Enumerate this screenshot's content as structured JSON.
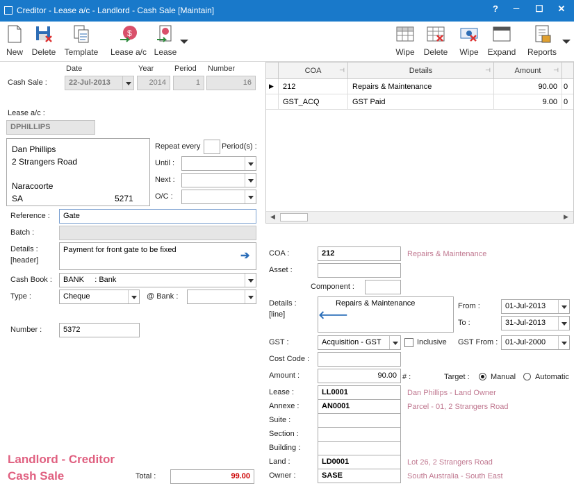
{
  "window": {
    "title": "Creditor - Lease a/c - Landlord - Cash Sale [Maintain]",
    "help": "?",
    "minimize": "─",
    "maximize": "☐",
    "close": "✕"
  },
  "toolbar_left": {
    "new": "New",
    "delete": "Delete",
    "template": "Template",
    "lease_ac": "Lease a/c",
    "lease": "Lease"
  },
  "toolbar_right": {
    "wipe1": "Wipe",
    "delete": "Delete",
    "wipe2": "Wipe",
    "expand": "Expand",
    "reports": "Reports"
  },
  "header": {
    "col_date": "Date",
    "col_year": "Year",
    "col_period": "Period",
    "col_number": "Number",
    "cash_sale_label": "Cash Sale :",
    "date": "22-Jul-2013",
    "year": "2014",
    "period": "1",
    "number": "16"
  },
  "lease_ac": {
    "label": "Lease a/c :",
    "code": "DPHILLIPS",
    "address": [
      "Dan Phillips",
      "2 Strangers Road",
      "",
      "Naracoorte"
    ],
    "state": "SA",
    "postcode": "5271"
  },
  "repeat": {
    "repeat_every": "Repeat every",
    "periods": "Period(s) :",
    "until": "Until :",
    "next": "Next :",
    "oc": "O/C :"
  },
  "form": {
    "reference_label": "Reference :",
    "reference": "Gate",
    "batch_label": "Batch :",
    "details_label": "Details :",
    "details_sub": "[header]",
    "details": "Payment for front gate to be fixed",
    "cashbook_label": "Cash Book :",
    "cashbook": "BANK     : Bank",
    "type_label": "Type :",
    "type": "Cheque",
    "at_bank_label": "@ Bank :",
    "number_label": "Number :",
    "number": "5372"
  },
  "footer": {
    "brand_line1": "Landlord - Creditor",
    "brand_line2": "Cash Sale",
    "total_label": "Total :",
    "total": "99.00"
  },
  "grid": {
    "headers": [
      "COA",
      "Details",
      "Amount",
      ""
    ],
    "rows": [
      {
        "coa": "212",
        "details": "Repairs & Maintenance",
        "amount": "90.00",
        "extra": "0"
      },
      {
        "coa": "GST_ACQ",
        "details": "GST Paid",
        "amount": "9.00",
        "extra": "0"
      }
    ]
  },
  "line": {
    "coa_label": "COA :",
    "coa": "212",
    "coa_desc": "Repairs & Maintenance",
    "asset_label": "Asset :",
    "component_label": "Component :",
    "details_label": "Details :",
    "details_sub": "[line]",
    "details": "Repairs & Maintenance",
    "from_label": "From :",
    "from": "01-Jul-2013",
    "to_label": "To :",
    "to": "31-Jul-2013",
    "gst_label": "GST :",
    "gst": "Acquisition - GST",
    "inclusive": "Inclusive",
    "gst_from_label": "GST From :",
    "gst_from": "01-Jul-2000",
    "cost_code_label": "Cost Code :",
    "amount_label": "Amount :",
    "amount": "90.00",
    "hash": "# :",
    "target_label": "Target :",
    "manual": "Manual",
    "automatic": "Automatic",
    "lease_label": "Lease :",
    "lease": "LL0001",
    "lease_desc": "Dan Phillips - Land Owner",
    "annexe_label": "Annexe :",
    "annexe": "AN0001",
    "annexe_desc": "Parcel - 01, 2 Strangers Road",
    "suite_label": "Suite :",
    "section_label": "Section :",
    "building_label": "Building :",
    "land_label": "Land :",
    "land": "LD0001",
    "land_desc": "Lot 26, 2 Strangers Road",
    "owner_label": "Owner :",
    "owner": "SASE",
    "owner_desc": "South Australia - South East"
  },
  "colors": {
    "titlebar": "#1979ca",
    "accent_pink": "#e06080",
    "total_red": "#cc0000"
  }
}
